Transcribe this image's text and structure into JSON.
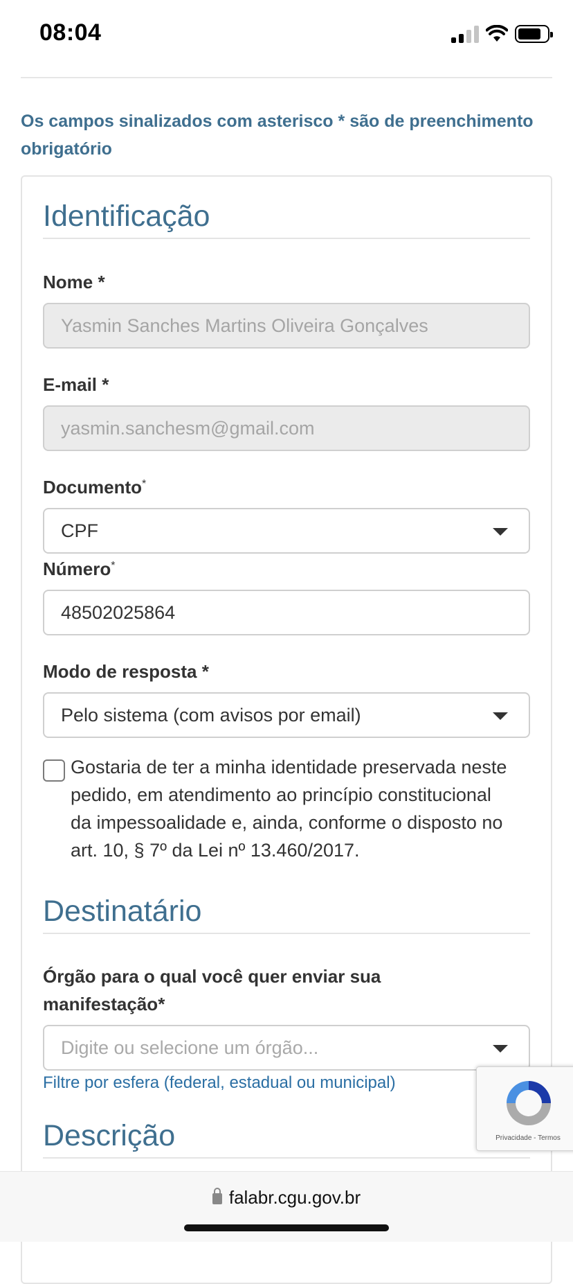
{
  "status_bar": {
    "time": "08:04"
  },
  "notice": "Os campos sinalizados com asterisco * são de preenchimento obrigatório",
  "identification": {
    "title": "Identificação",
    "name_label": "Nome",
    "name_required": "*",
    "name_value": "Yasmin Sanches Martins Oliveira Gonçalves",
    "email_label": "E-mail",
    "email_required": "*",
    "email_value": "yasmin.sanchesm@gmail.com",
    "document_label": "Documento",
    "document_required": "*",
    "document_value": "CPF",
    "number_label": "Número",
    "number_required": "*",
    "number_value": "48502025864",
    "response_label": "Modo de resposta",
    "response_required": "*",
    "response_value": "Pelo sistema (com avisos por email)",
    "privacy_text": "Gostaria de ter a minha identidade preservada neste pedido, em atendimento ao princípio constitucional da impessoalidade e, ainda, conforme o disposto no art. 10, § 7º da Lei nº 13.460/2017."
  },
  "recipient": {
    "title": "Destinatário",
    "org_label": "Órgão para o qual você quer enviar sua manifestação",
    "org_required": "*",
    "org_placeholder": "Digite ou selecione um órgão...",
    "filter_link": "Filtre por esfera (federal, estadual ou municipal)"
  },
  "description": {
    "title": "Descrição"
  },
  "recaptcha": {
    "links": "Privacidade - Termos"
  },
  "browser": {
    "url": "falabr.cgu.gov.br"
  }
}
